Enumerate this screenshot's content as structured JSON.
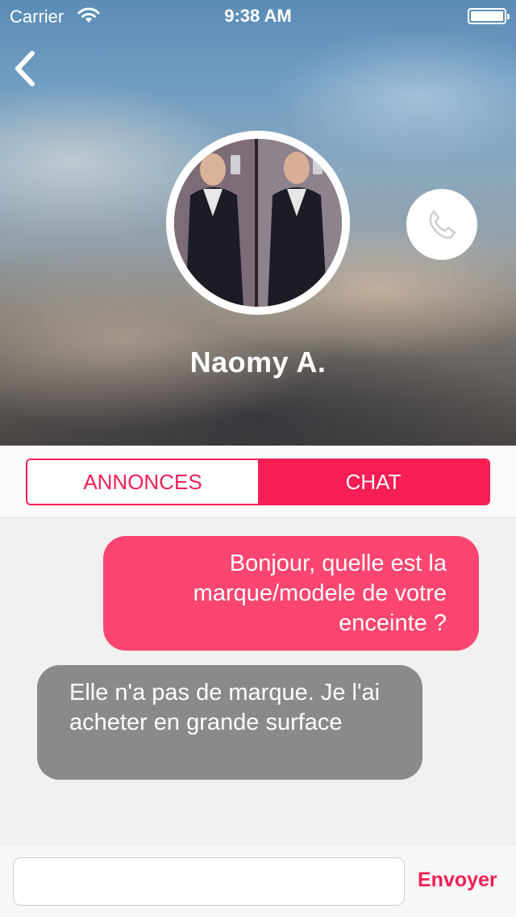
{
  "status_bar": {
    "carrier": "Carrier",
    "time": "9:38 AM",
    "icons": [
      "wifi-icon",
      "battery-icon"
    ]
  },
  "header": {
    "back_icon": "chevron-left-icon",
    "profile_name": "Naomy A.",
    "call_icon": "phone-icon"
  },
  "tabs": {
    "items": [
      {
        "label": "ANNONCES",
        "active": false
      },
      {
        "label": "CHAT",
        "active": true
      }
    ],
    "accent": "#f81d55"
  },
  "messages": [
    {
      "direction": "out",
      "text": "Bonjour, quelle est la marque/modele de votre enceinte ?",
      "color": "#fc4570"
    },
    {
      "direction": "in",
      "text": "Elle n'a pas de marque. Je l'ai acheter en grande surface",
      "color": "#8a8a8a"
    }
  ],
  "composer": {
    "value": "",
    "placeholder": "",
    "send_label": "Envoyer"
  }
}
